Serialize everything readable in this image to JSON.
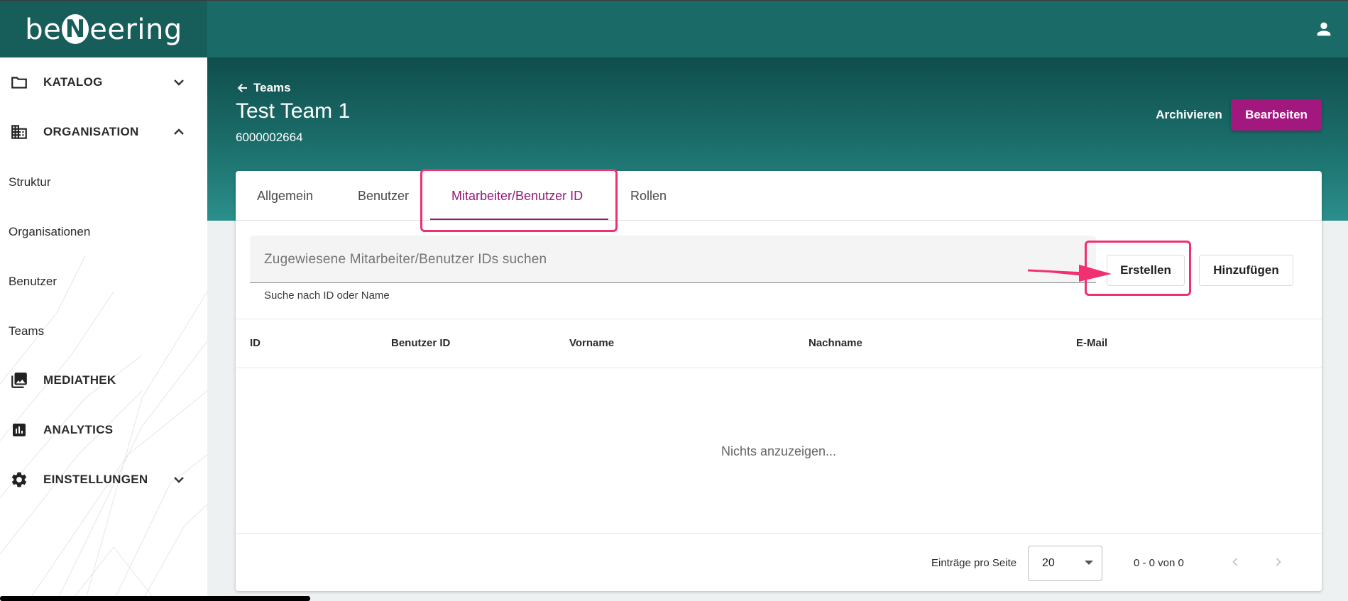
{
  "brand": {
    "logo_text_before": "be",
    "logo_letter": "N",
    "logo_text_after": "eering"
  },
  "sidebar": {
    "items": [
      {
        "label": "KATALOG",
        "icon": "folder-icon",
        "chevron": "down"
      },
      {
        "label": "ORGANISATION",
        "icon": "building-icon",
        "chevron": "up"
      },
      {
        "label": "MEDIATHEK",
        "icon": "media-icon"
      },
      {
        "label": "ANALYTICS",
        "icon": "analytics-icon"
      },
      {
        "label": "EINSTELLUNGEN",
        "icon": "gear-icon",
        "chevron": "down"
      }
    ],
    "sub_items": [
      "Struktur",
      "Organisationen",
      "Benutzer",
      "Teams"
    ]
  },
  "header": {
    "back_label": "Teams",
    "title": "Test Team 1",
    "subtitle": "6000002664",
    "archive_label": "Archivieren",
    "edit_label": "Bearbeiten"
  },
  "tabs": [
    {
      "label": "Allgemein",
      "active": false
    },
    {
      "label": "Benutzer",
      "active": false
    },
    {
      "label": "Mitarbeiter/Benutzer ID",
      "active": true
    },
    {
      "label": "Rollen",
      "active": false
    }
  ],
  "search": {
    "placeholder": "Zugewiesene Mitarbeiter/Benutzer IDs suchen",
    "hint": "Suche nach ID oder Name"
  },
  "actions": {
    "create_label": "Erstellen",
    "add_label": "Hinzufügen"
  },
  "table": {
    "columns": [
      "ID",
      "Benutzer ID",
      "Vorname",
      "Nachname",
      "E-Mail"
    ],
    "rows": [],
    "empty_text": "Nichts anzuzeigen..."
  },
  "pagination": {
    "per_page_label": "Einträge pro Seite",
    "per_page_value": "20",
    "range_text": "0 - 0 von 0"
  },
  "colors": {
    "primary": "#1a6b68",
    "accent": "#a3187f",
    "highlight": "#f0306f"
  }
}
